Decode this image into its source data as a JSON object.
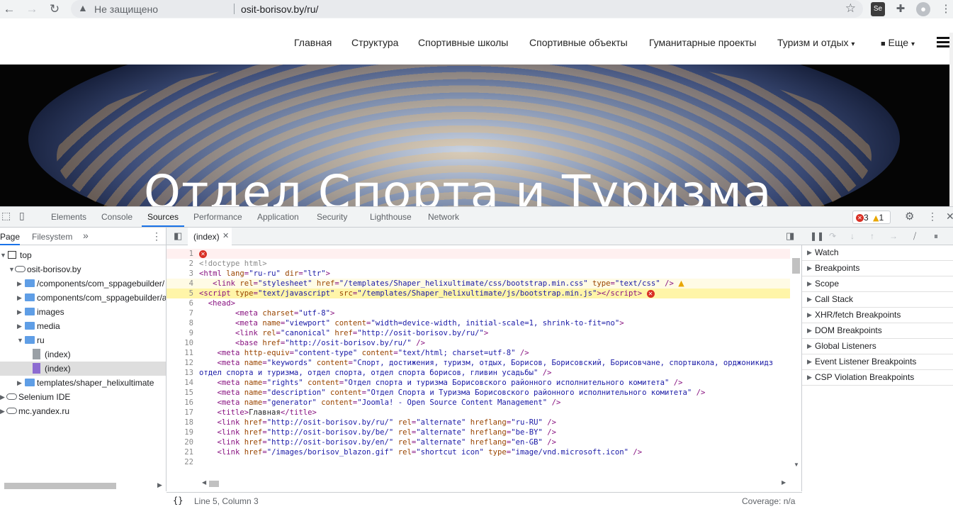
{
  "browser": {
    "insecure_label": "Не защищено",
    "url": "osit-borisov.by/ru/",
    "ext_se": "Se"
  },
  "site": {
    "nav": [
      "Главная",
      "Структура",
      "Спортивные школы",
      "Спортивные объекты",
      "Гуманитарные проекты",
      "Туризм и отдых"
    ],
    "more_label": "Еще",
    "hero_title": "Отдел Спорта и Туризма"
  },
  "devtools": {
    "tabs": [
      "Elements",
      "Console",
      "Sources",
      "Performance",
      "Application",
      "Security",
      "Lighthouse",
      "Network"
    ],
    "active_tab": "Sources",
    "issues_errors": "3",
    "issues_warnings": "1",
    "navigator": {
      "tabs": [
        "Page",
        "Filesystem"
      ],
      "tree": [
        {
          "label": "top",
          "kind": "frame",
          "level": 0,
          "open": true
        },
        {
          "label": "osit-borisov.by",
          "kind": "cloud",
          "level": 1,
          "open": true
        },
        {
          "label": "/components/com_sppagebuilder/",
          "kind": "folder",
          "level": 2,
          "open": false
        },
        {
          "label": "components/com_sppagebuilder/a",
          "kind": "folder",
          "level": 2,
          "open": false
        },
        {
          "label": "images",
          "kind": "folder",
          "level": 2,
          "open": false
        },
        {
          "label": "media",
          "kind": "folder",
          "level": 2,
          "open": false
        },
        {
          "label": "ru",
          "kind": "folder",
          "level": 2,
          "open": true
        },
        {
          "label": "(index)",
          "kind": "file",
          "level": 3
        },
        {
          "label": "(index)",
          "kind": "file-purple",
          "level": 3,
          "selected": true
        },
        {
          "label": "templates/shaper_helixultimate",
          "kind": "folder",
          "level": 2,
          "open": false
        },
        {
          "label": "Selenium IDE",
          "kind": "cloud",
          "level": 0,
          "open": false
        },
        {
          "label": "mc.yandex.ru",
          "kind": "cloud",
          "level": 0,
          "open": false
        }
      ]
    },
    "editor": {
      "tab": "(index)",
      "status_position": "Line 5, Column 3",
      "status_coverage": "Coverage: n/a",
      "lines": [
        {
          "n": "1",
          "html": "",
          "err": true
        },
        {
          "n": "2",
          "html": "<span class='cm'>&lt;!doctype html&gt;</span>"
        },
        {
          "n": "3",
          "html": "<span class='tag'>&lt;html</span> <span class='an'>lang</span>=<span class='av'>\"ru-ru\"</span> <span class='an'>dir</span>=<span class='av'>\"ltr\"</span><span class='tag'>&gt;</span>"
        },
        {
          "n": "4",
          "html": "   <span class='tag'>&lt;link</span> <span class='an'>rel</span>=<span class='av'>\"stylesheet\"</span> <span class='an'>href</span>=<span class='av'>\"/templates/Shaper_helixultimate/css/bootstrap.min.css\"</span> <span class='an'>type</span>=<span class='av'>\"text/css\"</span> <span class='tag'>/&gt;</span> <span class='badge-warn'>▲</span>",
          "warn": true
        },
        {
          "n": "5",
          "html": "<span class='tag'>&lt;script</span> <span class='an'>type</span>=<span class='av'>\"text/javascript\"</span> <span class='an'>src</span>=<span class='av'>\"/templates/Shaper_helixultimate/js/bootstrap.min.js\"</span><span class='tag'>&gt;&lt;/script&gt;</span> <span class='badge-err'>✕</span>",
          "hl": true
        },
        {
          "n": "6",
          "html": "  <span class='tag'>&lt;head&gt;</span>"
        },
        {
          "n": "7",
          "html": "        <span class='tag'>&lt;meta</span> <span class='an'>charset</span>=<span class='av'>\"utf-8\"</span><span class='tag'>&gt;</span>"
        },
        {
          "n": "8",
          "html": "        <span class='tag'>&lt;meta</span> <span class='an'>name</span>=<span class='av'>\"viewport\"</span> <span class='an'>content</span>=<span class='av'>\"width=device-width, initial-scale=1, shrink-to-fit=no\"</span><span class='tag'>&gt;</span>"
        },
        {
          "n": "9",
          "html": "        <span class='tag'>&lt;link</span> <span class='an'>rel</span>=<span class='av'>\"canonical\"</span> <span class='an'>href</span>=<span class='av'>\"http://osit-borisov.by/ru/\"</span><span class='tag'>&gt;</span>"
        },
        {
          "n": "10",
          "html": "        <span class='tag'>&lt;base</span> <span class='an'>href</span>=<span class='av'>\"http://osit-borisov.by/ru/\"</span> <span class='tag'>/&gt;</span>"
        },
        {
          "n": "11",
          "html": "    <span class='tag'>&lt;meta</span> <span class='an'>http-equiv</span>=<span class='av'>\"content-type\"</span> <span class='an'>content</span>=<span class='av'>\"text/html; charset=utf-8\"</span> <span class='tag'>/&gt;</span>"
        },
        {
          "n": "12",
          "html": "    <span class='tag'>&lt;meta</span> <span class='an'>name</span>=<span class='av'>\"keywords\"</span> <span class='an'>content</span>=<span class='av'>\"Спорт, достижения, туризм, отдых, Борисов, Борисовский, Борисовчане, спортшкола, орджоникидз</span>"
        },
        {
          "n": "13",
          "html": "<span class='av'>отдел спорта и туризма, отдел спорта, отдел спорта борисов, гливин усадьбы\"</span> <span class='tag'>/&gt;</span>"
        },
        {
          "n": "14",
          "html": "    <span class='tag'>&lt;meta</span> <span class='an'>name</span>=<span class='av'>\"rights\"</span> <span class='an'>content</span>=<span class='av'>\"Отдел спорта и туризма Борисовского районного исполнительного комитета\"</span> <span class='tag'>/&gt;</span>"
        },
        {
          "n": "15",
          "html": "    <span class='tag'>&lt;meta</span> <span class='an'>name</span>=<span class='av'>\"description\"</span> <span class='an'>content</span>=<span class='av'>\"Отдел Спорта и Туризма Борисовского районного исполнительного комитета\"</span> <span class='tag'>/&gt;</span>"
        },
        {
          "n": "16",
          "html": "    <span class='tag'>&lt;meta</span> <span class='an'>name</span>=<span class='av'>\"generator\"</span> <span class='an'>content</span>=<span class='av'>\"Joomla! - Open Source Content Management\"</span> <span class='tag'>/&gt;</span>"
        },
        {
          "n": "17",
          "html": "    <span class='tag'>&lt;title&gt;</span><span class='tt'>Главная</span><span class='tag'>&lt;/title&gt;</span>"
        },
        {
          "n": "18",
          "html": "    <span class='tag'>&lt;link</span> <span class='an'>href</span>=<span class='av'>\"http://osit-borisov.by/ru/\"</span> <span class='an'>rel</span>=<span class='av'>\"alternate\"</span> <span class='an'>hreflang</span>=<span class='av'>\"ru-RU\"</span> <span class='tag'>/&gt;</span>"
        },
        {
          "n": "19",
          "html": "    <span class='tag'>&lt;link</span> <span class='an'>href</span>=<span class='av'>\"http://osit-borisov.by/be/\"</span> <span class='an'>rel</span>=<span class='av'>\"alternate\"</span> <span class='an'>hreflang</span>=<span class='av'>\"be-BY\"</span> <span class='tag'>/&gt;</span>"
        },
        {
          "n": "20",
          "html": "    <span class='tag'>&lt;link</span> <span class='an'>href</span>=<span class='av'>\"http://osit-borisov.by/en/\"</span> <span class='an'>rel</span>=<span class='av'>\"alternate\"</span> <span class='an'>hreflang</span>=<span class='av'>\"en-GB\"</span> <span class='tag'>/&gt;</span>"
        },
        {
          "n": "21",
          "html": "    <span class='tag'>&lt;link</span> <span class='an'>href</span>=<span class='av'>\"/images/borisov_blazon.gif\"</span> <span class='an'>rel</span>=<span class='av'>\"shortcut icon\"</span> <span class='an'>type</span>=<span class='av'>\"image/vnd.microsoft.icon\"</span> <span class='tag'>/&gt;</span>"
        },
        {
          "n": "22",
          "html": ""
        }
      ]
    },
    "debugger": {
      "panes": [
        "Watch",
        "Breakpoints",
        "Scope",
        "Call Stack",
        "XHR/fetch Breakpoints",
        "DOM Breakpoints",
        "Global Listeners",
        "Event Listener Breakpoints",
        "CSP Violation Breakpoints"
      ]
    }
  }
}
